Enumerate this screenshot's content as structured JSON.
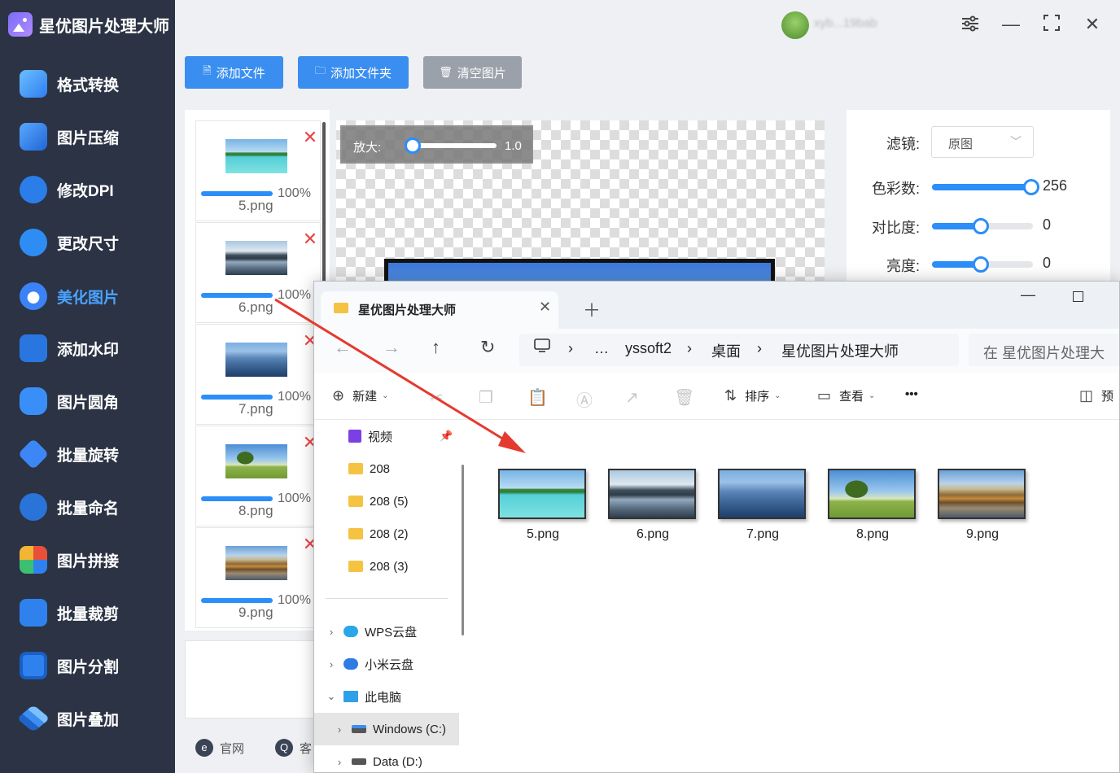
{
  "app": {
    "title": "星优图片处理大师",
    "user_name": "xyb...19bab"
  },
  "window_controls": {
    "settings_icon": "sliders-icon",
    "minimize": "—",
    "maximize": "⛶",
    "close": "✕"
  },
  "sidebar": {
    "items": [
      {
        "label": "格式转换",
        "icon": "format-convert-icon",
        "color": "#4aa3ff"
      },
      {
        "label": "图片压缩",
        "icon": "compress-icon",
        "color": "#3d8ef0"
      },
      {
        "label": "修改DPI",
        "icon": "dpi-icon",
        "color": "#2b7de9"
      },
      {
        "label": "更改尺寸",
        "icon": "resize-icon",
        "color": "#2e8df5"
      },
      {
        "label": "美化图片",
        "icon": "beautify-icon",
        "color": "#3b82f6",
        "active": true
      },
      {
        "label": "添加水印",
        "icon": "watermark-icon",
        "color": "#2a76e0"
      },
      {
        "label": "图片圆角",
        "icon": "round-corner-icon",
        "color": "#3a8ef8"
      },
      {
        "label": "批量旋转",
        "icon": "rotate-icon",
        "color": "#3d86f5"
      },
      {
        "label": "批量命名",
        "icon": "rename-icon",
        "color": "#2a73d8"
      },
      {
        "label": "图片拼接",
        "icon": "puzzle-icon",
        "color": "#e8503a"
      },
      {
        "label": "批量裁剪",
        "icon": "crop-icon",
        "color": "#2f82ee"
      },
      {
        "label": "图片分割",
        "icon": "split-icon",
        "color": "#2f82ee"
      },
      {
        "label": "图片叠加",
        "icon": "layers-icon",
        "color": "#2f82ee"
      }
    ]
  },
  "toolbar": {
    "add_file": "添加文件",
    "add_folder": "添加文件夹",
    "clear_images": "清空图片",
    "primary_color": "#3a8ef0",
    "secondary_color": "#9aa1ab"
  },
  "files": [
    {
      "name": "5.png",
      "percent": "100%",
      "progress": 1.0,
      "thumb": "beach"
    },
    {
      "name": "6.png",
      "percent": "100%",
      "progress": 1.0,
      "thumb": "lake"
    },
    {
      "name": "7.png",
      "percent": "100%",
      "progress": 1.0,
      "thumb": "mountains"
    },
    {
      "name": "8.png",
      "percent": "100%",
      "progress": 1.0,
      "thumb": "tree"
    },
    {
      "name": "9.png",
      "percent": "100%",
      "progress": 1.0,
      "thumb": "autumn"
    }
  ],
  "preview": {
    "zoom_label": "放大:",
    "zoom_value": "1.0",
    "zoom_level": 0.1
  },
  "settings": {
    "filter_label": "滤镜:",
    "filter_value": "原图",
    "color_count_label": "色彩数:",
    "color_count_value": "256",
    "color_count_level": 1.0,
    "contrast_label": "对比度:",
    "contrast_value": "0",
    "contrast_level": 0.5,
    "brightness_label": "亮度:",
    "brightness_value": "0",
    "brightness_level": 0.5
  },
  "footer": {
    "website": "官网",
    "support": "客"
  },
  "explorer": {
    "tab_title": "星优图片处理大师",
    "breadcrumbs": [
      "…",
      "yssoft2",
      "桌面",
      "星优图片处理大师"
    ],
    "search_placeholder": "在 星优图片处理大",
    "commands": {
      "new": "新建",
      "sort": "排序",
      "view": "查看",
      "more": "•••",
      "preview": "预"
    },
    "quick_access": [
      {
        "label": "视频",
        "type": "video"
      },
      {
        "label": "208",
        "type": "folder"
      },
      {
        "label": "208 (5)",
        "type": "folder"
      },
      {
        "label": "208 (2)",
        "type": "folder"
      },
      {
        "label": "208 (3)",
        "type": "folder"
      }
    ],
    "locations": [
      {
        "label": "WPS云盘",
        "chevron": "›"
      },
      {
        "label": "小米云盘",
        "chevron": "›"
      },
      {
        "label": "此电脑",
        "chevron": "⌄"
      },
      {
        "label": "Windows (C:)",
        "chevron": "›",
        "selected": true
      },
      {
        "label": "Data (D:)",
        "chevron": "›"
      }
    ],
    "files": [
      {
        "name": "5.png",
        "thumb": "beach"
      },
      {
        "name": "6.png",
        "thumb": "lake"
      },
      {
        "name": "7.png",
        "thumb": "mountains"
      },
      {
        "name": "8.png",
        "thumb": "tree"
      },
      {
        "name": "9.png",
        "thumb": "autumn"
      }
    ]
  }
}
